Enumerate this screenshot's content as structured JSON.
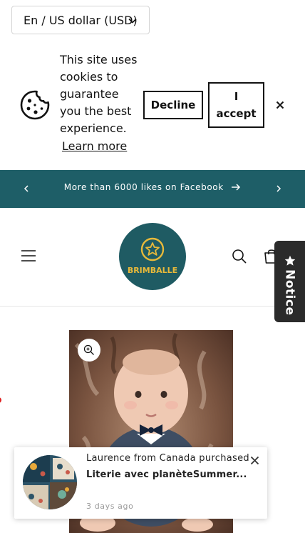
{
  "currency_selector": {
    "label": "En / US dollar (USD)"
  },
  "cookie_banner": {
    "message": "This site uses cookies to guarantee you the best experience.",
    "learn_more": "Learn more",
    "decline_label": "Decline",
    "accept_label": "I accept"
  },
  "announcement": {
    "message": "More than 6000 likes on Facebook"
  },
  "header": {
    "logo_text": "BRIMBALLE"
  },
  "notice_tab": {
    "label": "Notice"
  },
  "purchase_popup": {
    "buyer": "Laurence from Canada purchased",
    "product": "Literie avec planèteSummer...",
    "time": "3 days ago"
  },
  "colors": {
    "announcement_bg": "#1e5e67",
    "logo_bg": "#1f5b63",
    "logo_accent": "#e8b93a",
    "notice_bg": "#2b2b2b"
  },
  "icons": [
    "cookie-icon",
    "chevron-down-icon",
    "close-icon",
    "arrow-left-icon",
    "arrow-right-icon",
    "menu-icon",
    "search-icon",
    "cart-icon",
    "star-icon",
    "zoom-icon"
  ]
}
